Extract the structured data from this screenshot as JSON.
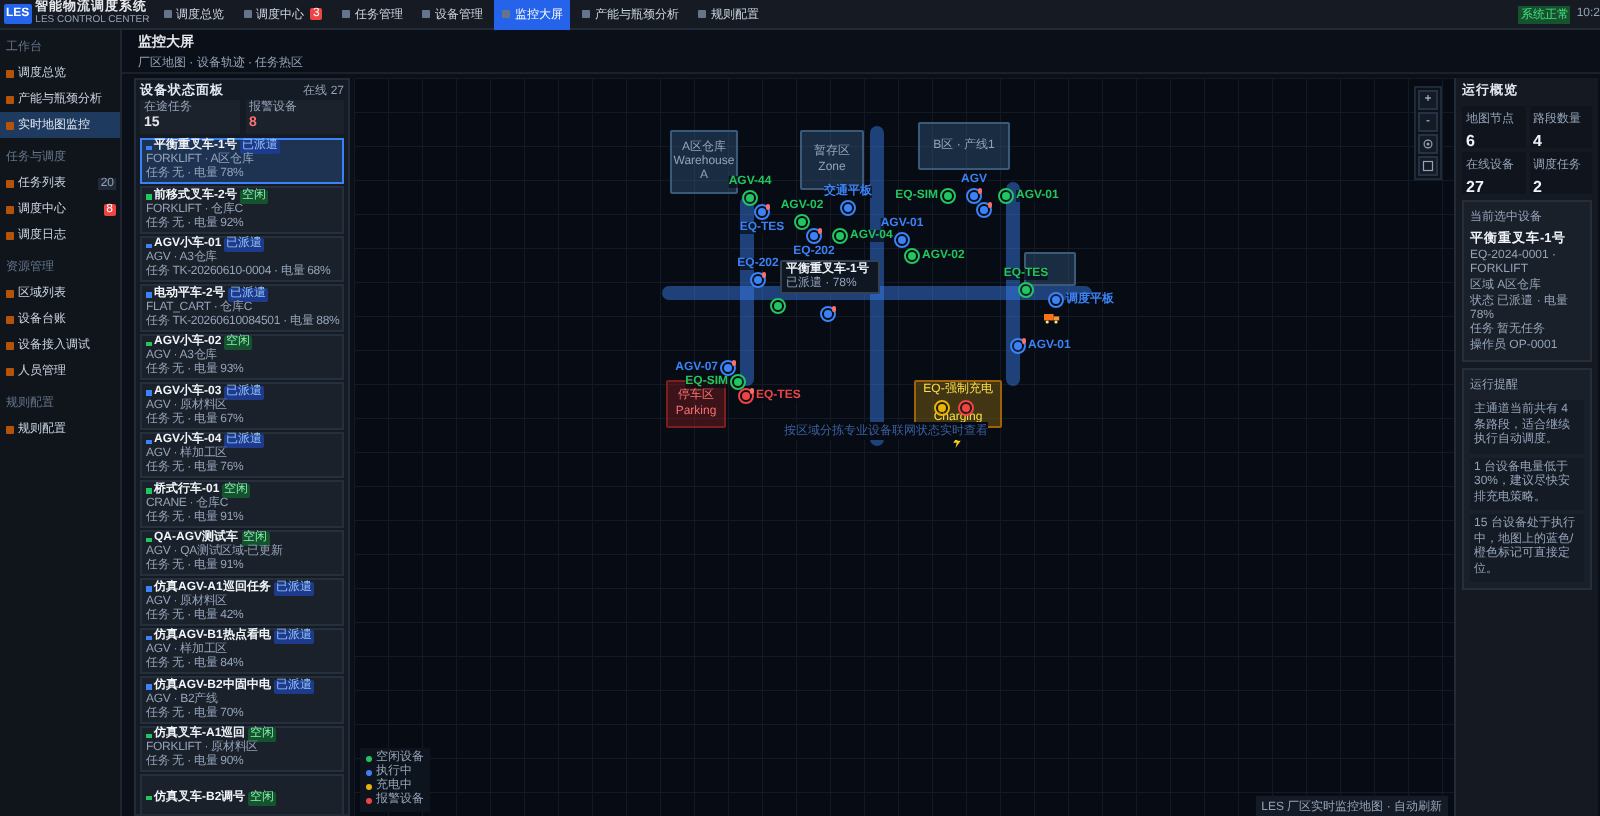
{
  "app": {
    "logo": "LES",
    "title": "智能物流调度系统",
    "subtitle": "LES CONTROL CENTER"
  },
  "nav": [
    {
      "label": "调度总览",
      "selected": false
    },
    {
      "label": "调度中心",
      "selected": false,
      "badge": "3"
    },
    {
      "label": "任务管理",
      "selected": false
    },
    {
      "label": "设备管理",
      "selected": false
    },
    {
      "label": "监控大屏",
      "selected": true
    },
    {
      "label": "产能与瓶颈分析",
      "selected": false
    },
    {
      "label": "规则配置",
      "selected": false
    }
  ],
  "status": {
    "label": "系统正常",
    "time": "10:2"
  },
  "sidebar": [
    {
      "title": "工作台",
      "items": [
        {
          "label": "调度总览",
          "selected": false
        },
        {
          "label": "产能与瓶颈分析",
          "selected": false
        },
        {
          "label": "实时地图监控",
          "selected": true
        }
      ]
    },
    {
      "title": "任务与调度",
      "items": [
        {
          "label": "任务列表",
          "selected": false,
          "count": "20"
        },
        {
          "label": "调度中心",
          "selected": false,
          "badge": "8"
        },
        {
          "label": "调度日志",
          "selected": false
        }
      ]
    },
    {
      "title": "资源管理",
      "items": [
        {
          "label": "区域列表",
          "selected": false
        },
        {
          "label": "设备台账",
          "selected": false
        },
        {
          "label": "设备接入调试",
          "selected": false
        },
        {
          "label": "人员管理",
          "selected": false
        }
      ]
    },
    {
      "title": "规则配置",
      "items": [
        {
          "label": "规则配置",
          "selected": false
        }
      ]
    }
  ],
  "page": {
    "title": "监控大屏",
    "subtitle": "厂区地图 · 设备轨迹 · 任务热区"
  },
  "device_panel": {
    "title": "设备状态面板",
    "online": "在线 27",
    "stats": [
      {
        "label": "在途任务",
        "value": "15",
        "kind": "normal"
      },
      {
        "label": "报警设备",
        "value": "8",
        "kind": "alarm"
      }
    ],
    "devices": [
      {
        "name": "平衡重叉车-1号",
        "status": "已派遣",
        "kind": "busy",
        "selected": true,
        "meta": "FORKLIFT · A区仓库",
        "info": "任务 无 · 电量 78%"
      },
      {
        "name": "前移式叉车-2号",
        "status": "空闲",
        "kind": "idle",
        "selected": false,
        "meta": "FORKLIFT · 仓库C",
        "info": "任务 无 · 电量 92%"
      },
      {
        "name": "AGV小车-01",
        "status": "已派遣",
        "kind": "busy",
        "selected": false,
        "meta": "AGV · A3仓库",
        "info": "任务 TK-20260610-0004 · 电量 68%"
      },
      {
        "name": "电动平车-2号",
        "status": "已派遣",
        "kind": "busy",
        "selected": false,
        "meta": "FLAT_CART · 仓库C",
        "info": "任务 TK-20260610084501 · 电量 88%"
      },
      {
        "name": "AGV小车-02",
        "status": "空闲",
        "kind": "idle",
        "selected": false,
        "meta": "AGV · A3仓库",
        "info": "任务 无 · 电量 93%"
      },
      {
        "name": "AGV小车-03",
        "status": "已派遣",
        "kind": "busy",
        "selected": false,
        "meta": "AGV · 原材料区",
        "info": "任务 无 · 电量 67%"
      },
      {
        "name": "AGV小车-04",
        "status": "已派遣",
        "kind": "busy",
        "selected": false,
        "meta": "AGV · 样加工区",
        "info": "任务 无 · 电量 76%"
      },
      {
        "name": "桥式行车-01",
        "status": "空闲",
        "kind": "idle",
        "selected": false,
        "meta": "CRANE · 仓库C",
        "info": "任务 无 · 电量 91%"
      },
      {
        "name": "QA-AGV测试车",
        "status": "空闲",
        "kind": "idle",
        "selected": false,
        "meta": "AGV · QA测试区域-已更新",
        "info": "任务 无 · 电量 91%"
      },
      {
        "name": "仿真AGV-A1巡回任务",
        "status": "已派遣",
        "kind": "busy",
        "selected": false,
        "meta": "AGV · 原材料区",
        "info": "任务 无 · 电量 42%"
      },
      {
        "name": "仿真AGV-B1热点看电",
        "status": "已派遣",
        "kind": "busy",
        "selected": false,
        "meta": "AGV · 样加工区",
        "info": "任务 无 · 电量 84%"
      },
      {
        "name": "仿真AGV-B2中固中电",
        "status": "已派遣",
        "kind": "busy",
        "selected": false,
        "meta": "AGV · B2产线",
        "info": "任务 无 · 电量 70%"
      },
      {
        "name": "仿真叉车-A1巡回",
        "status": "空闲",
        "kind": "idle",
        "selected": false,
        "meta": "FORKLIFT · 原材料区",
        "info": "任务 无 · 电量 90%"
      },
      {
        "name": "仿真叉车-B2调号",
        "status": "空闲",
        "kind": "idle",
        "selected": false
      }
    ]
  },
  "map": {
    "zones": [
      {
        "name": "A区仓库",
        "sub": "Warehouse A",
        "kind": "normal"
      },
      {
        "name": "暂存区",
        "sub": "Zone",
        "kind": "normal"
      },
      {
        "name": "B区 · 产线1",
        "kind": "normal"
      },
      {
        "kind": "normal"
      },
      {
        "name": "停车区",
        "sub": "Parking",
        "kind": "parking"
      },
      {
        "name": "EQ-强制充电",
        "sub": "Charging",
        "kind": "charging"
      }
    ],
    "markers": [
      {
        "label": "AGV-44",
        "kind": "idle",
        "warning": false
      },
      {
        "label": "EQ-TES",
        "kind": "busy",
        "warning": true
      },
      {
        "label": "AGV-02",
        "kind": "idle",
        "warning": false
      },
      {
        "label": "EQ-202",
        "kind": "busy",
        "warning": true
      },
      {
        "label": "AGV-04",
        "kind": "idle",
        "warning": false
      },
      {
        "label": "交通平板",
        "kind": "busy",
        "warning": false
      },
      {
        "label": "AGV-01",
        "kind": "busy",
        "warning": false
      },
      {
        "label": "AGV-02",
        "kind": "idle",
        "warning": false
      },
      {
        "label": "EQ-SIM",
        "kind": "idle",
        "warning": false
      },
      {
        "label": "AGV",
        "kind": "busy",
        "warning": true
      },
      {
        "label": "AGV-01",
        "kind": "idle",
        "warning": false
      },
      {
        "kind": "busy",
        "warning": true
      },
      {
        "label": "EQ-202",
        "kind": "busy",
        "warning": true
      },
      {
        "kind": "idle",
        "warning": false
      },
      {
        "kind": "busy",
        "warning": true
      },
      {
        "label": "EQ-TES",
        "kind": "idle",
        "warning": false
      },
      {
        "label": "调度平板",
        "kind": "busy",
        "warning": false
      },
      {
        "label": "AGV-01",
        "kind": "busy",
        "warning": true
      },
      {
        "label": "AGV-07",
        "kind": "busy",
        "warning": true
      },
      {
        "label": "EQ-SIM",
        "kind": "idle",
        "warning": false
      },
      {
        "label": "EQ-TES",
        "kind": "alarm",
        "warning": true
      },
      {
        "kind": "charging",
        "warning": false
      },
      {
        "kind": "alarm",
        "warning": false
      }
    ],
    "tooltip": {
      "title": "平衡重叉车-1号",
      "detail": "已派遣 · 78%"
    },
    "caption": "按区域分拣专业设备联网状态实时查看",
    "controls": [
      "+",
      "-"
    ],
    "legend": [
      {
        "label": "空闲设备",
        "color": "#22c55e"
      },
      {
        "label": "执行中",
        "color": "#3b82f6"
      },
      {
        "label": "充电中",
        "color": "#eab308"
      },
      {
        "label": "报警设备",
        "color": "#ef4444"
      }
    ],
    "hint": "LES 厂区实时监控地图 · 自动刷新"
  },
  "overview": {
    "title": "运行概览",
    "stats": [
      {
        "label": "地图节点",
        "value": "6"
      },
      {
        "label": "路段数量",
        "value": "4"
      },
      {
        "label": "在线设备",
        "value": "27"
      },
      {
        "label": "调度任务",
        "value": "2"
      }
    ],
    "selected": {
      "title": "当前选中设备",
      "name": "平衡重叉车-1号",
      "lines": [
        "EQ-2024-0001 · FORKLIFT",
        "区域 A区仓库",
        "状态 已派遣 · 电量 78%",
        "任务 暂无任务",
        "操作员 OP-0001"
      ]
    },
    "reminders": {
      "title": "运行提醒",
      "notes": [
        "主通道当前共有 4 条路段，适合继续执行自动调度。",
        "1 台设备电量低于 30%，建议尽快安排充电策略。",
        "15 台设备处于执行中，地图上的蓝色/橙色标记可直接定位。"
      ]
    }
  }
}
